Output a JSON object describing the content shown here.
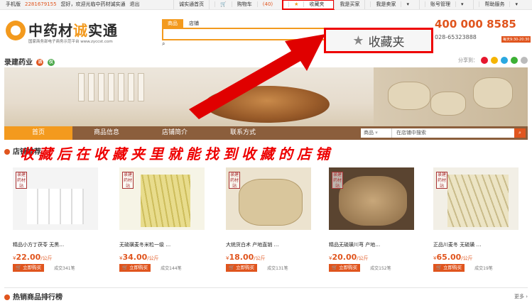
{
  "topbar": {
    "mobile_label": "手机版",
    "phone": "2281679155",
    "welcome": "您好，欢迎光临中药材诚实通",
    "logout": "退出",
    "links": [
      {
        "label": "诚实通首页"
      },
      {
        "label": "购物车",
        "count": "(40)"
      },
      {
        "label": "收藏夹"
      },
      {
        "label": "我是买家"
      },
      {
        "label": "我是卖家"
      },
      {
        "label": "账号管理"
      },
      {
        "label": "帮助服务"
      }
    ]
  },
  "header": {
    "logo_text_a": "中药材",
    "logo_text_b": "诚",
    "logo_text_c": "实通",
    "logo_sub": "国家商务部电子商务示范平台 www.zyccst.com",
    "search_tabs": [
      "商品",
      "店铺"
    ],
    "hotline": "400 000 8585",
    "hotline2": "028-65323888",
    "hot_time": "每天9:30-20:30",
    "fav_callout": "收藏夹"
  },
  "shop": {
    "name": "录建药业",
    "badge_1": "派",
    "badge_2": "仪",
    "share_label": "分享到："
  },
  "nav": {
    "items": [
      "首页",
      "商品信息",
      "店铺简介",
      "联系方式"
    ],
    "search_select": "商品",
    "search_placeholder": "在店铺中搜索"
  },
  "section": {
    "title": "店铺推荐",
    "overlay_text": "收藏后在收藏夹里就能找到收藏的店铺"
  },
  "products": [
    {
      "name": "精品小方丁茯苓 无黑…",
      "price": "22.00",
      "unit": "/公斤",
      "buy": "立即购买",
      "sold": "成交341笔"
    },
    {
      "name": "无硫磺麦冬米粒一级 …",
      "price": "34.00",
      "unit": "/公斤",
      "buy": "立即购买",
      "sold": "成交144笔"
    },
    {
      "name": "大统货白术 产地直销 …",
      "price": "18.00",
      "unit": "/公斤",
      "buy": "立即购买",
      "sold": "成交131笔"
    },
    {
      "name": "精品无硫磺川芎 产地…",
      "price": "20.00",
      "unit": "/公斤",
      "buy": "立即购买",
      "sold": "成交152笔"
    },
    {
      "name": "正品川麦冬 无硫磺 …",
      "price": "65.00",
      "unit": "/公斤",
      "buy": "立即购买",
      "sold": "成交19笔"
    }
  ],
  "product_watermark": "录建药材站",
  "hot": {
    "title": "热销商品排行榜",
    "more": "更多"
  },
  "colors": {
    "accent": "#f39a1e",
    "brand_red": "#e0551e",
    "nav_brown": "#8b5e3c",
    "annotation_red": "#e00000"
  }
}
